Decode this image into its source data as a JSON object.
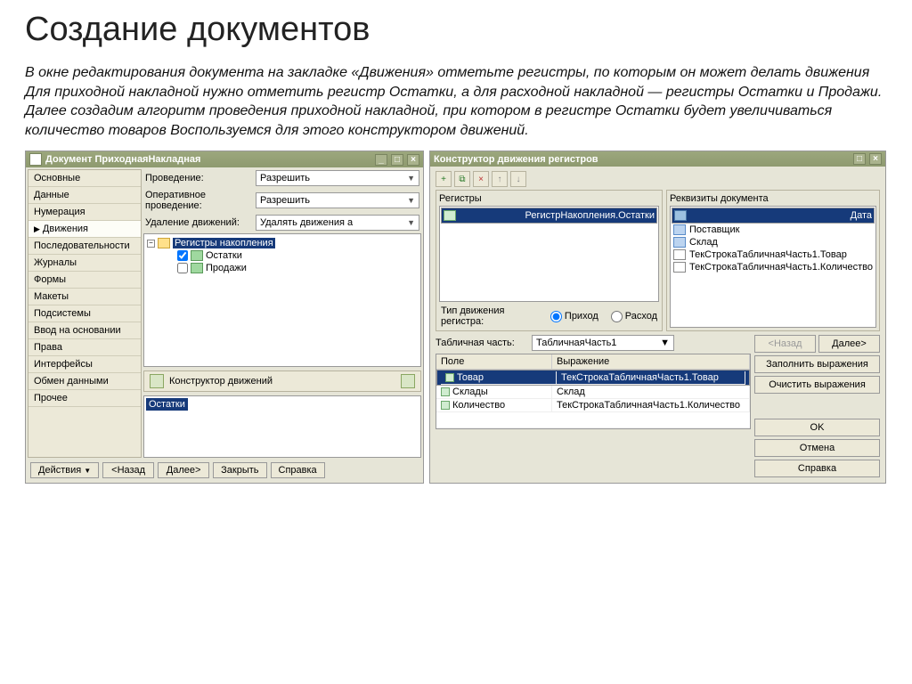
{
  "slide": {
    "title": "Создание документов",
    "desc": "В окне редактирования документа на закладке «Движения» отметьте регистры, по которым он может делать движения Для приходной накладной нужно отметить регистр Остатки, а для расходной накладной — регистры Остатки и Продажи. Далее создадим алгоритм проведения приходной накладной, при котором в регистре Остатки будет увеличиваться количество товаров Воспользуемся для этого конструктором движений."
  },
  "left": {
    "title": "Документ ПриходнаяНакладная",
    "nav": [
      "Основные",
      "Данные",
      "Нумерация",
      "Движения",
      "Последовательности",
      "Журналы",
      "Формы",
      "Макеты",
      "Подсистемы",
      "Ввод на основании",
      "Права",
      "Интерфейсы",
      "Обмен данными",
      "Прочее"
    ],
    "nav_active": "Движения",
    "form": {
      "l_provedenie": "Проведение:",
      "v_provedenie": "Разрешить",
      "l_oper": "Оперативное проведение:",
      "v_oper": "Разрешить",
      "l_udal": "Удаление движений:",
      "v_udal": "Удалять движения а"
    },
    "tree": {
      "root": "Регистры накопления",
      "child1": "Остатки",
      "child1_checked": true,
      "child2": "Продажи",
      "child2_checked": false
    },
    "constr_label": "Конструктор движений",
    "reg_selected": "Остатки",
    "buttons": {
      "actions": "Действия",
      "back": "<Назад",
      "next": "Далее>",
      "close": "Закрыть",
      "help": "Справка"
    }
  },
  "right": {
    "title": "Конструктор движения регистров",
    "panels": {
      "reg_label": "Регистры",
      "reg_item": "РегистрНакопления.Остатки",
      "rekv_label": "Реквизиты документа",
      "rekv": [
        "Дата",
        "Поставщик",
        "Склад",
        "ТекСтрокаТабличнаяЧасть1.Товар",
        "ТекСтрокаТабличнаяЧасть1.Количество"
      ]
    },
    "radio": {
      "label": "Тип движения регистра:",
      "opt1": "Приход",
      "opt2": "Расход"
    },
    "tp_label": "Табличная часть:",
    "tp_value": "ТабличнаяЧасть1",
    "table": {
      "h_field": "Поле",
      "h_expr": "Выражение",
      "rows": [
        {
          "field": "Товар",
          "expr": "ТекСтрокаТабличнаяЧасть1.Товар",
          "sel": true
        },
        {
          "field": "Склады",
          "expr": "Склад"
        },
        {
          "field": "Количество",
          "expr": "ТекСтрокаТабличнаяЧасть1.Количество"
        }
      ]
    },
    "buttons": {
      "back": "<Назад",
      "next": "Далее>",
      "fill": "Заполнить выражения",
      "clear": "Очистить выражения",
      "ok": "OK",
      "cancel": "Отмена",
      "help": "Справка"
    }
  }
}
